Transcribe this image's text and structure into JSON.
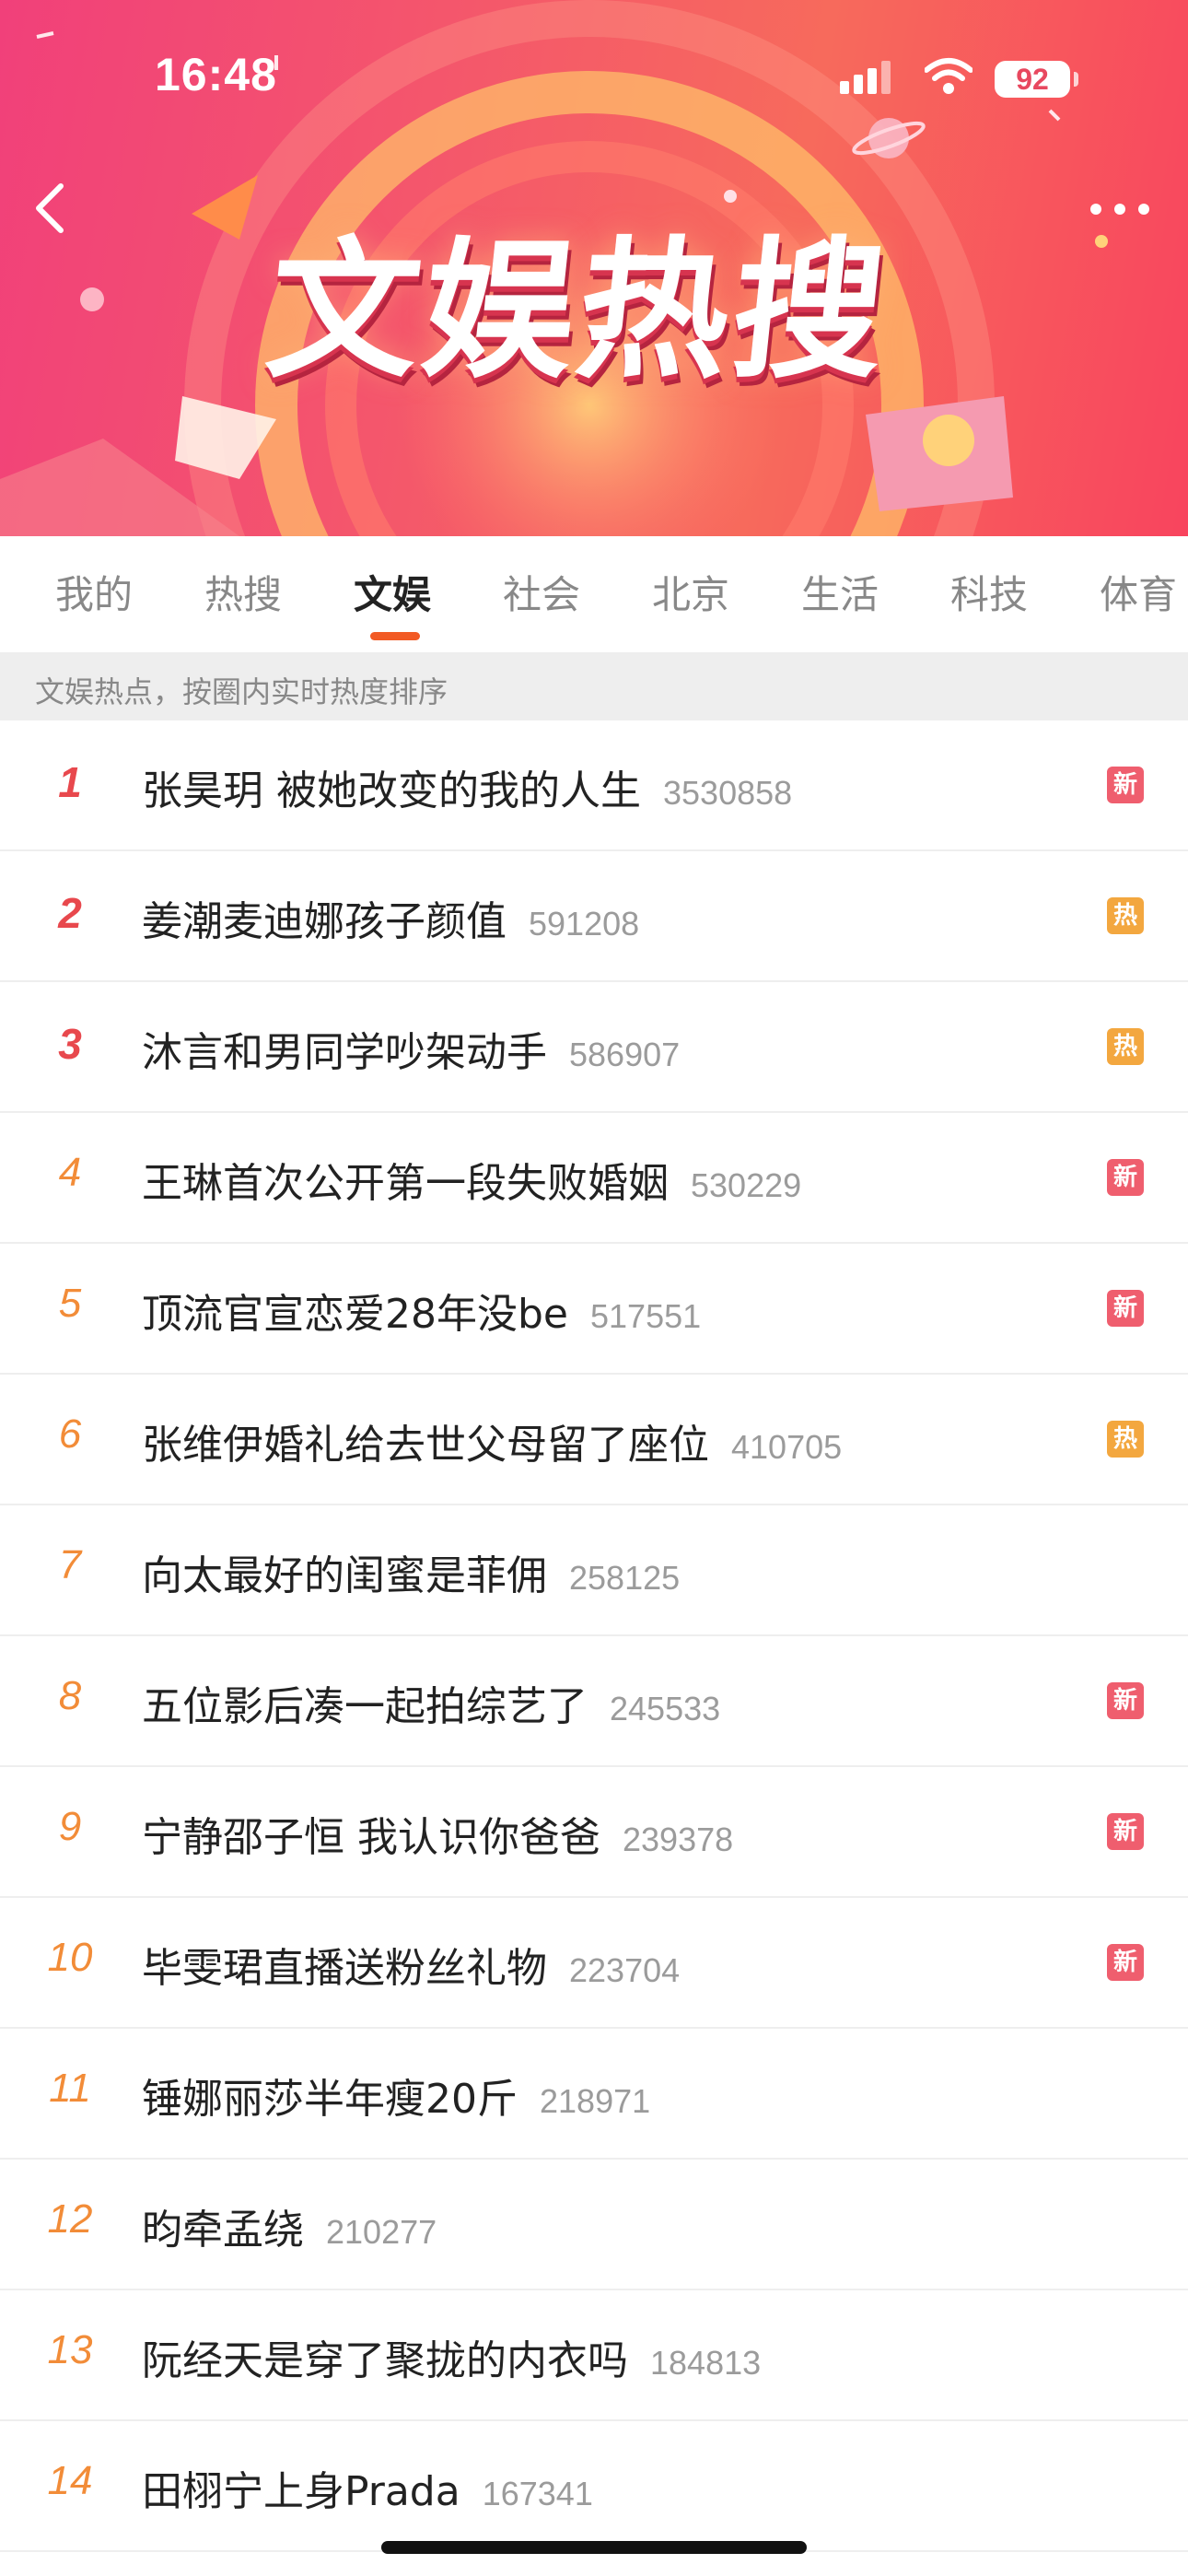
{
  "status_bar": {
    "time": "16:48",
    "battery": "92"
  },
  "header": {
    "banner_title": "文娱热搜"
  },
  "tabs": [
    {
      "label": "我的",
      "active": false
    },
    {
      "label": "热搜",
      "active": false
    },
    {
      "label": "文娱",
      "active": true
    },
    {
      "label": "社会",
      "active": false
    },
    {
      "label": "北京",
      "active": false
    },
    {
      "label": "生活",
      "active": false
    },
    {
      "label": "科技",
      "active": false
    },
    {
      "label": "体育",
      "active": false
    }
  ],
  "subheader": "文娱热点，按圈内实时热度排序",
  "badge_labels": {
    "new": "新",
    "hot": "热"
  },
  "colors": {
    "accent": "#f25a24",
    "top_rank": "#e8484d",
    "rank": "#f28c38",
    "new_badge": "#ef5e6e",
    "hot_badge": "#f3a73f"
  },
  "list": [
    {
      "rank": "1",
      "title": "张昊玥 被她改变的我的人生",
      "count": "3530858",
      "badge": "新"
    },
    {
      "rank": "2",
      "title": "姜潮麦迪娜孩子颜值",
      "count": "591208",
      "badge": "热"
    },
    {
      "rank": "3",
      "title": "沐言和男同学吵架动手",
      "count": "586907",
      "badge": "热"
    },
    {
      "rank": "4",
      "title": "王琳首次公开第一段失败婚姻",
      "count": "530229",
      "badge": "新"
    },
    {
      "rank": "5",
      "title": "顶流官宣恋爱28年没be",
      "count": "517551",
      "badge": "新"
    },
    {
      "rank": "6",
      "title": "张维伊婚礼给去世父母留了座位",
      "count": "410705",
      "badge": "热"
    },
    {
      "rank": "7",
      "title": "向太最好的闺蜜是菲佣",
      "count": "258125",
      "badge": ""
    },
    {
      "rank": "8",
      "title": "五位影后凑一起拍综艺了",
      "count": "245533",
      "badge": "新"
    },
    {
      "rank": "9",
      "title": "宁静邵子恒 我认识你爸爸",
      "count": "239378",
      "badge": "新"
    },
    {
      "rank": "10",
      "title": "毕雯珺直播送粉丝礼物",
      "count": "223704",
      "badge": "新"
    },
    {
      "rank": "11",
      "title": "锤娜丽莎半年瘦20斤",
      "count": "218971",
      "badge": ""
    },
    {
      "rank": "12",
      "title": "昀牵孟绕",
      "count": "210277",
      "badge": ""
    },
    {
      "rank": "13",
      "title": "阮经天是穿了聚拢的内衣吗",
      "count": "184813",
      "badge": ""
    },
    {
      "rank": "14",
      "title": "田栩宁上身Prada",
      "count": "167341",
      "badge": ""
    }
  ]
}
